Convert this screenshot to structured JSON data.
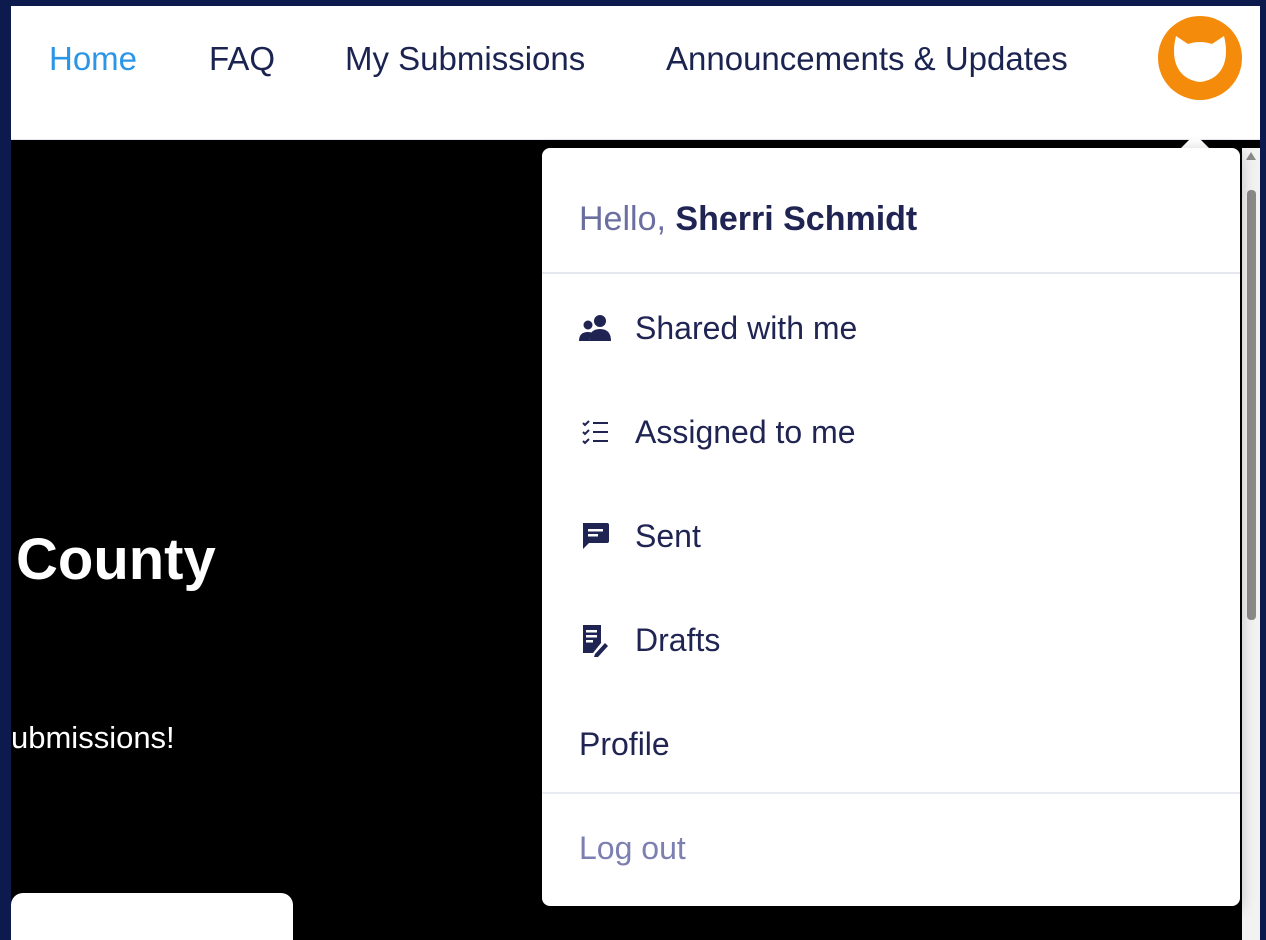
{
  "nav": {
    "items": [
      {
        "label": "Home",
        "active": true
      },
      {
        "label": "FAQ",
        "active": false
      },
      {
        "label": "My Submissions",
        "active": false
      },
      {
        "label": "Announcements & Updates",
        "active": false
      }
    ],
    "avatar_icon": "cat-face-icon",
    "accent_color": "#2b96e8",
    "avatar_color": "#f58b0a"
  },
  "hero": {
    "title_fragment": "County",
    "subtitle_fragment": "ubmissions!"
  },
  "user_menu": {
    "greeting_prefix": "Hello,",
    "user_name": "Sherri Schmidt",
    "items": [
      {
        "label": "Shared with me",
        "icon": "users-icon"
      },
      {
        "label": "Assigned to me",
        "icon": "checklist-icon"
      },
      {
        "label": "Sent",
        "icon": "message-icon"
      },
      {
        "label": "Drafts",
        "icon": "draft-document-icon"
      },
      {
        "label": "Profile",
        "icon": null
      }
    ],
    "logout_label": "Log out"
  }
}
